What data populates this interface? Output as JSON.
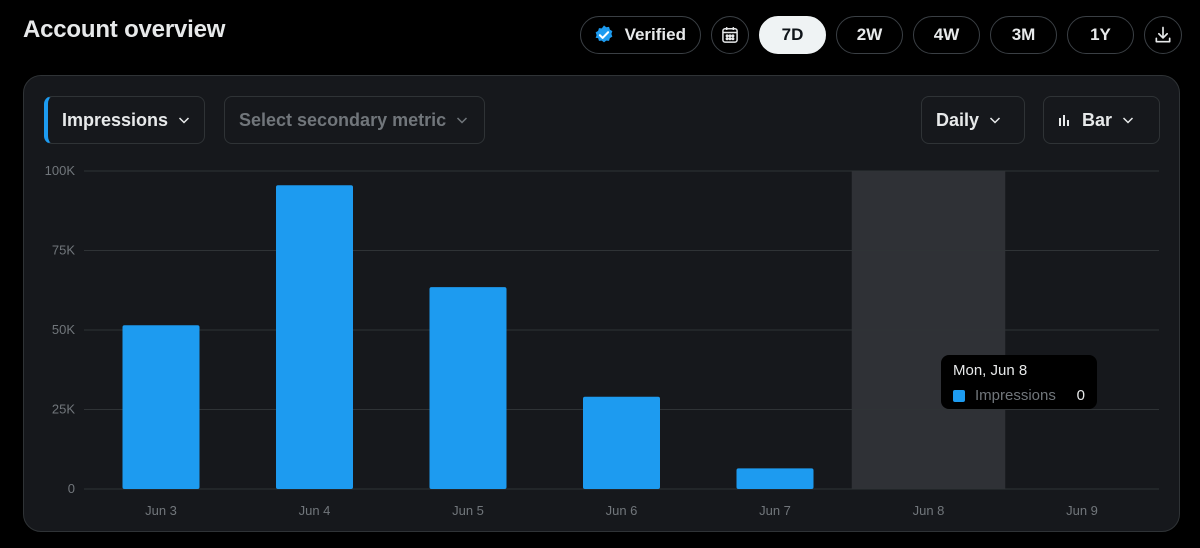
{
  "header": {
    "title": "Account overview"
  },
  "toolbar": {
    "verified_label": "Verified",
    "periods": [
      "7D",
      "2W",
      "4W",
      "3M",
      "1Y"
    ],
    "active_period": "7D"
  },
  "controls": {
    "primary_metric": "Impressions",
    "secondary_placeholder": "Select secondary metric",
    "granularity": "Daily",
    "chart_type": "Bar"
  },
  "colors": {
    "accent": "#1d9bf0",
    "background": "#000000",
    "panel": "#16181c",
    "highlight": "#2f3136"
  },
  "icons": [
    "verified-badge-icon",
    "calendar-icon",
    "download-icon",
    "chevron-down-icon",
    "bar-chart-icon"
  ],
  "tooltip": {
    "date": "Mon, Jun 8",
    "series": "Impressions",
    "value": "0"
  },
  "chart_data": {
    "type": "bar",
    "categories": [
      "Jun 3",
      "Jun 4",
      "Jun 5",
      "Jun 6",
      "Jun 7",
      "Jun 8",
      "Jun 9"
    ],
    "series": [
      {
        "name": "Impressions",
        "values": [
          51500,
          95500,
          63500,
          29000,
          6500,
          0,
          0
        ]
      }
    ],
    "yticks": [
      "0",
      "25K",
      "50K",
      "75K",
      "100K"
    ],
    "ylim": [
      0,
      100000
    ],
    "highlighted_category": "Jun 8",
    "grid": true
  }
}
